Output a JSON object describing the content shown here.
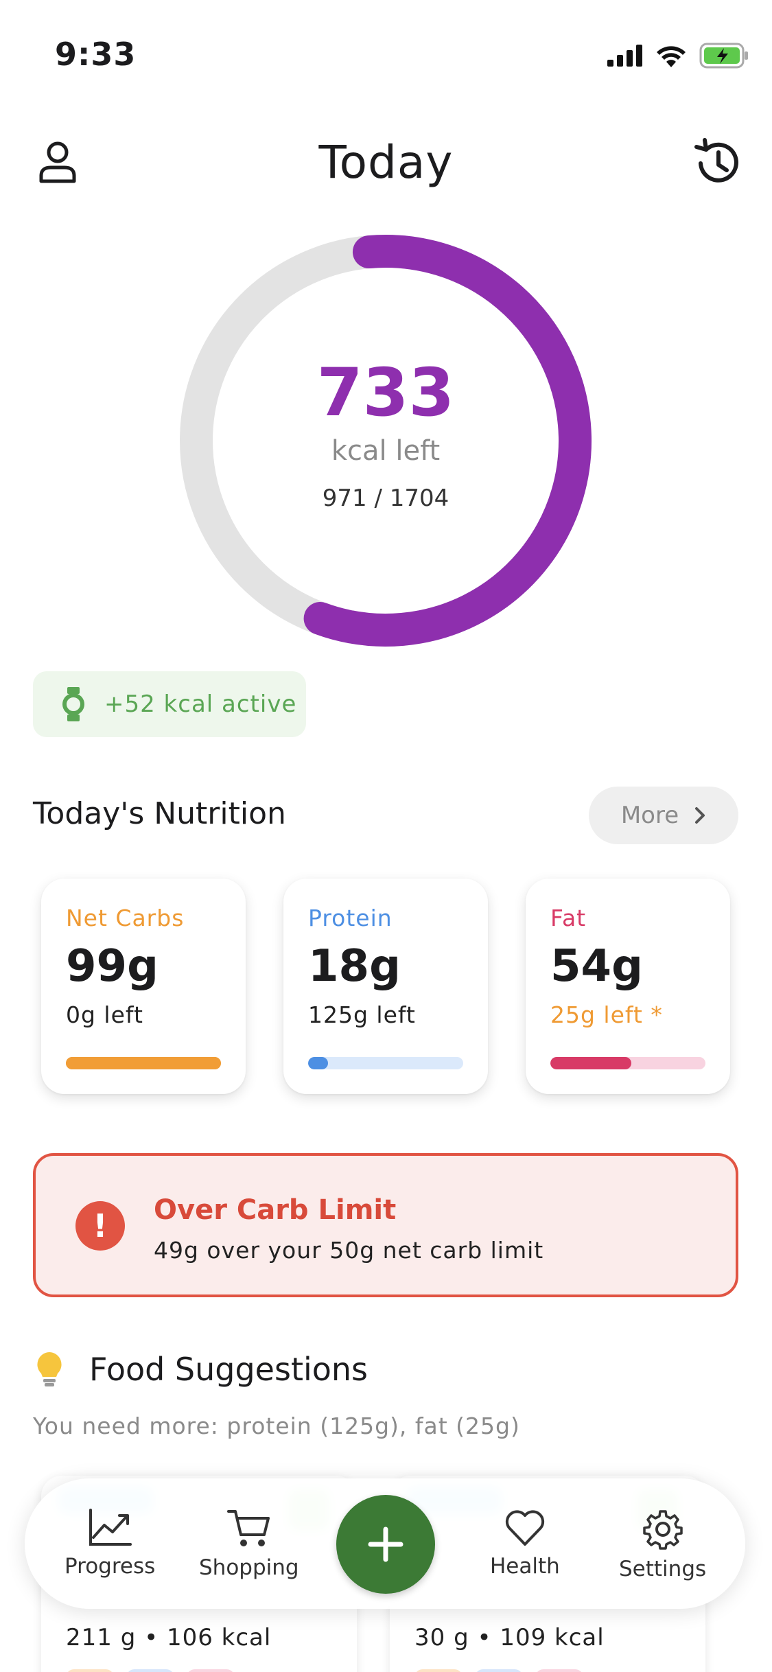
{
  "status_bar": {
    "time": "9:33"
  },
  "header": {
    "title": "Today",
    "profile_icon": "person-icon",
    "history_icon": "history-icon"
  },
  "calorie_ring": {
    "kcal_left": "733",
    "kcal_left_label": "kcal left",
    "consumed_ratio": "971 / 1704",
    "progress_fraction": 0.57,
    "progress_color": "#8e2fae",
    "track_color": "#e3e3e3"
  },
  "active_badge": {
    "icon": "watch-icon",
    "text": "+52 kcal active",
    "color": "#5aa654"
  },
  "nutrition": {
    "title": "Today's Nutrition",
    "more_label": "More",
    "macros": [
      {
        "label": "Net Carbs",
        "value": "99g",
        "left": "0g left",
        "label_color": "#ef9a33",
        "left_color": "#222222",
        "bar_color": "#f19d36",
        "track_color": "#f19d36",
        "fraction": 1.0
      },
      {
        "label": "Protein",
        "value": "18g",
        "left": "125g left",
        "label_color": "#4d8fe3",
        "left_color": "#222222",
        "bar_color": "#4d8fe3",
        "track_color": "#dbe9fb",
        "fraction": 0.13
      },
      {
        "label": "Fat",
        "value": "54g",
        "left": "25g left *",
        "label_color": "#d83a66",
        "left_color": "#ef9a33",
        "bar_color": "#d83a66",
        "track_color": "#f8d3e0",
        "fraction": 0.52
      }
    ]
  },
  "alert": {
    "icon": "exclamation-icon",
    "title": "Over Carb Limit",
    "body": "49g over your 50g net carb limit",
    "color": "#e15443"
  },
  "suggestions": {
    "icon": "lightbulb-icon",
    "title": "Food Suggestions",
    "need_text": "You need more: protein (125g), fat (25g)",
    "cards": [
      {
        "meta": "211 g • 106 kcal"
      },
      {
        "meta": "30 g • 109 kcal"
      }
    ]
  },
  "bottom_nav": {
    "items": [
      {
        "label": "Progress",
        "icon": "chart-icon"
      },
      {
        "label": "Shopping",
        "icon": "cart-icon"
      },
      {
        "label": "Health",
        "icon": "heart-icon"
      },
      {
        "label": "Settings",
        "icon": "gear-icon"
      }
    ],
    "fab_icon": "plus-icon",
    "fab_color": "#3c7a35"
  }
}
